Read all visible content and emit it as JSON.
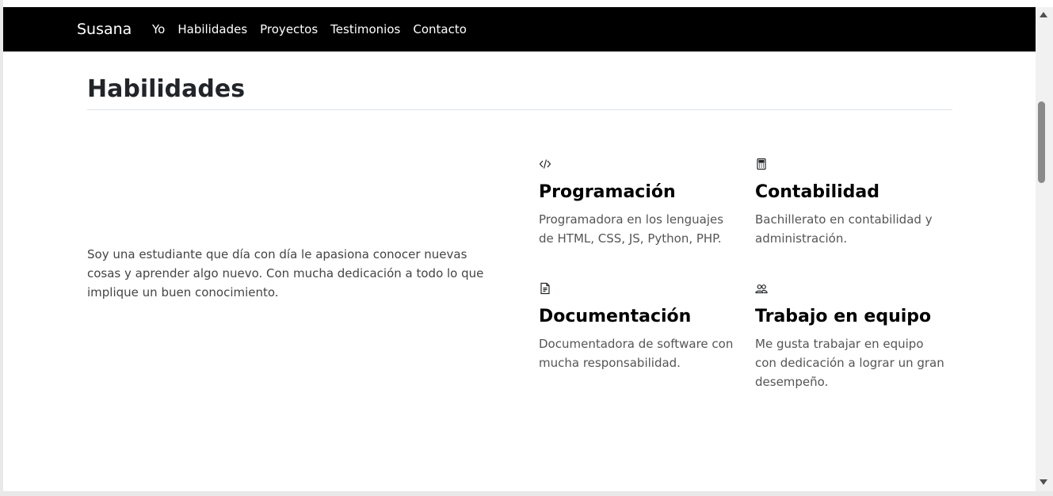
{
  "navbar": {
    "brand": "Susana",
    "links": [
      "Yo",
      "Habilidades",
      "Proyectos",
      "Testimonios",
      "Contacto"
    ]
  },
  "section": {
    "title": "Habilidades",
    "intro": "Soy una estudiante que día con día le apasiona conocer nuevas cosas y aprender algo nuevo. Con mucha dedicación a todo lo que implique un buen conocimiento."
  },
  "skills": [
    {
      "icon": "code-icon",
      "title": "Programación",
      "description": "Programadora en los lenguajes de HTML, CSS, JS, Python, PHP."
    },
    {
      "icon": "calculator-icon",
      "title": "Contabilidad",
      "description": "Bachillerato en contabilidad y administración."
    },
    {
      "icon": "document-icon",
      "title": "Documentación",
      "description": "Documentadora de software con mucha responsabilidad."
    },
    {
      "icon": "people-icon",
      "title": "Trabajo en equipo",
      "description": "Me gusta trabajar en equipo con dedicación a lograr un gran desempeño."
    }
  ],
  "colors": {
    "navbar_bg": "#000000",
    "nav_text": "#ffffff",
    "heading": "#212529",
    "body_text": "#555555"
  }
}
